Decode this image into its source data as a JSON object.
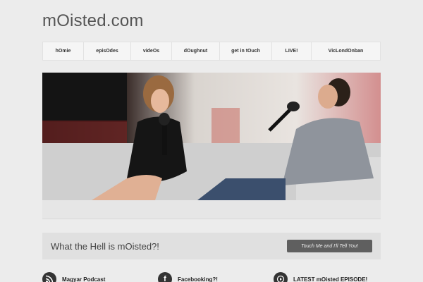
{
  "site": {
    "title": "mOisted.com"
  },
  "nav": {
    "items": [
      {
        "label": "hOmie"
      },
      {
        "label": "episOdes"
      },
      {
        "label": "videOs"
      },
      {
        "label": "dOughnut"
      },
      {
        "label": "get in tOuch"
      },
      {
        "label": "LIVE!"
      },
      {
        "label": "VicLondOnban"
      }
    ]
  },
  "cta": {
    "text": "What the Hell is mOisted?!",
    "button_label": "Touch Me and I'll Tell You!"
  },
  "features": [
    {
      "title": "Magyar Podcast",
      "icon": "rss-icon"
    },
    {
      "title": "Facebooking?!",
      "icon": "facebook-icon"
    },
    {
      "title": "LATEST mOisted EPISODE!",
      "icon": "play-icon"
    }
  ],
  "colors": {
    "background": "#ececec",
    "button": "#5f5f5f",
    "icon_circle": "#333333"
  }
}
